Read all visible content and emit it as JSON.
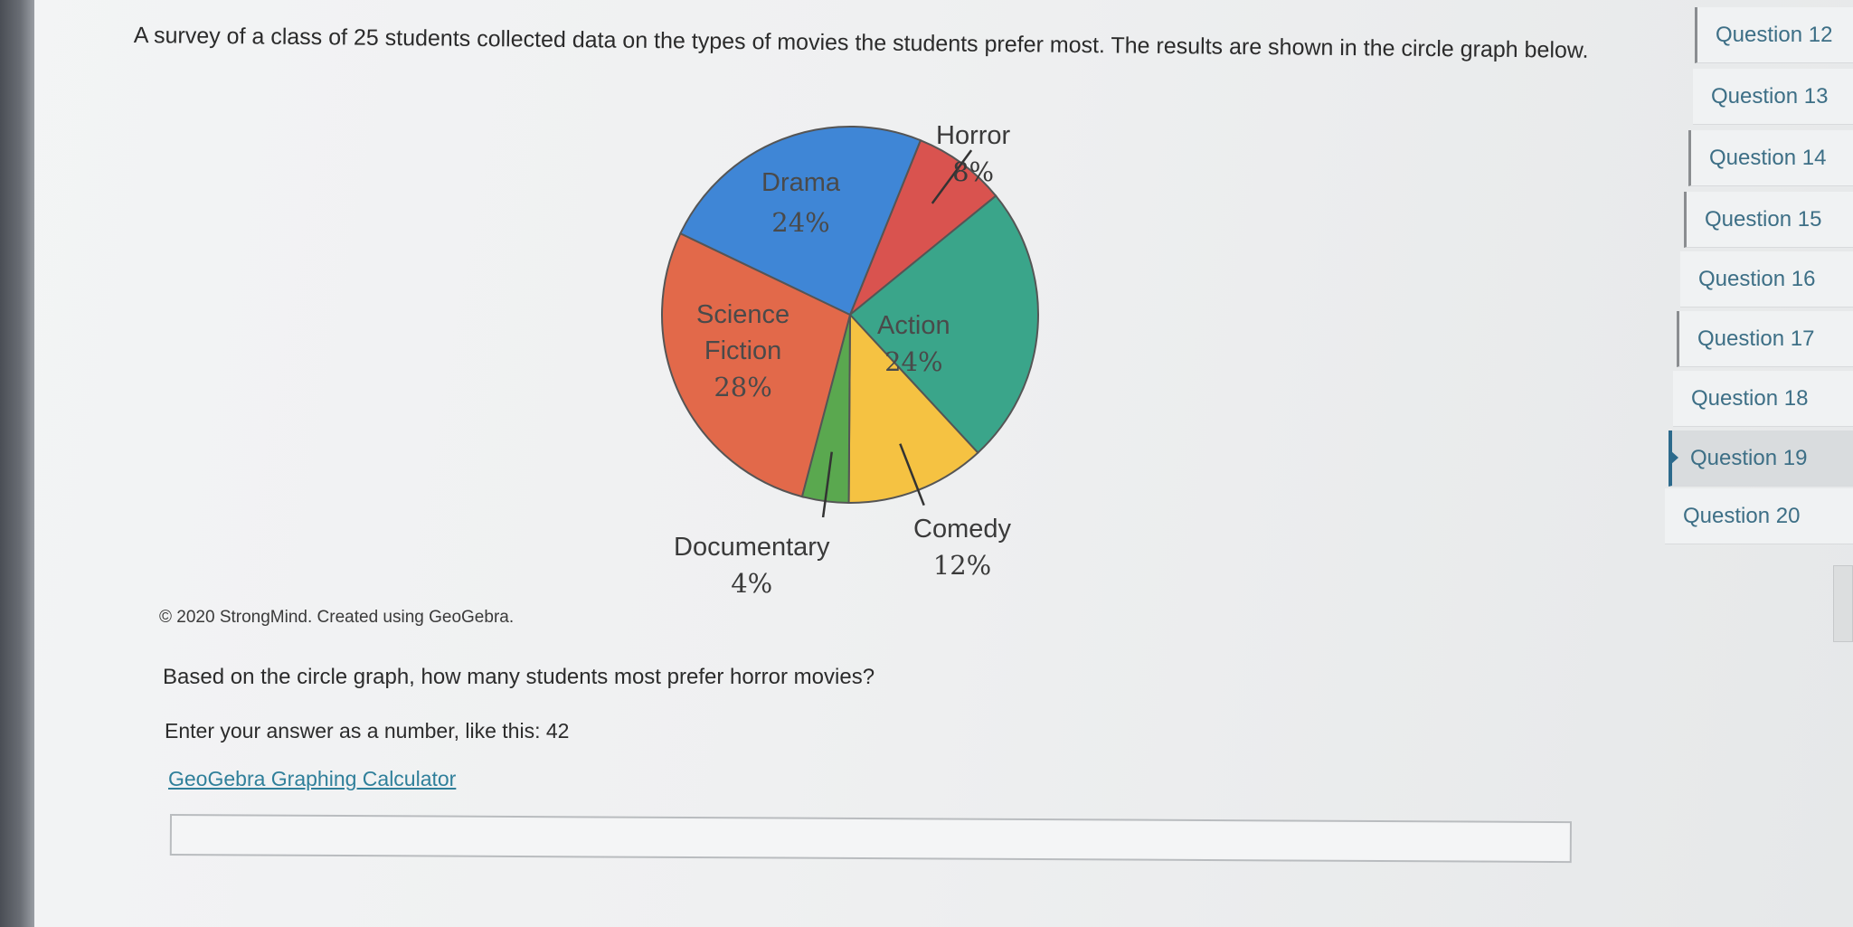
{
  "intro_text": "A survey of a class of 25 students collected data on the types of movies the students prefer most. The results are shown in the circle graph below.",
  "chart_data": {
    "type": "pie",
    "title": "",
    "slices": [
      {
        "name": "Horror",
        "percent_label": "8%",
        "value": 8,
        "color": "#d9534f"
      },
      {
        "name": "Action",
        "percent_label": "24%",
        "value": 24,
        "color": "#3aa58a"
      },
      {
        "name": "Comedy",
        "percent_label": "12%",
        "value": 12,
        "color": "#f5c242"
      },
      {
        "name": "Documentary",
        "percent_label": "4%",
        "value": 4,
        "color": "#5aa84f"
      },
      {
        "name": "Science Fiction",
        "percent_label": "28%",
        "value": 28,
        "color": "#e2694a"
      },
      {
        "name": "Drama",
        "percent_label": "24%",
        "value": 24,
        "color": "#3f86d6"
      }
    ]
  },
  "labels": {
    "horror": {
      "name": "Horror",
      "pct": "8%"
    },
    "action": {
      "name": "Action",
      "pct": "24%"
    },
    "comedy": {
      "name": "Comedy",
      "pct": "12%"
    },
    "documentary": {
      "name": "Documentary",
      "pct": "4%"
    },
    "scifi": {
      "line1": "Science",
      "line2": "Fiction",
      "pct": "28%"
    },
    "drama": {
      "name": "Drama",
      "pct": "24%"
    }
  },
  "copyright": "© 2020 StrongMind. Created using GeoGebra.",
  "question": "Based on the circle graph, how many students most prefer horror movies?",
  "instruction": "Enter your answer as a number, like this: 42",
  "calculator_link": "GeoGebra Graphing Calculator",
  "answer": {
    "value": "",
    "placeholder": ""
  },
  "question_nav": {
    "items": [
      {
        "label": "Question 12"
      },
      {
        "label": "Question 13"
      },
      {
        "label": "Question 14"
      },
      {
        "label": "Question 15"
      },
      {
        "label": "Question 16"
      },
      {
        "label": "Question 17"
      },
      {
        "label": "Question 18"
      },
      {
        "label": "Question 19"
      },
      {
        "label": "Question 20"
      }
    ],
    "active_index": 7
  },
  "colors": {
    "accent": "#2c6a8c",
    "link": "#2f7f9a",
    "pie_outline": "#555555"
  }
}
